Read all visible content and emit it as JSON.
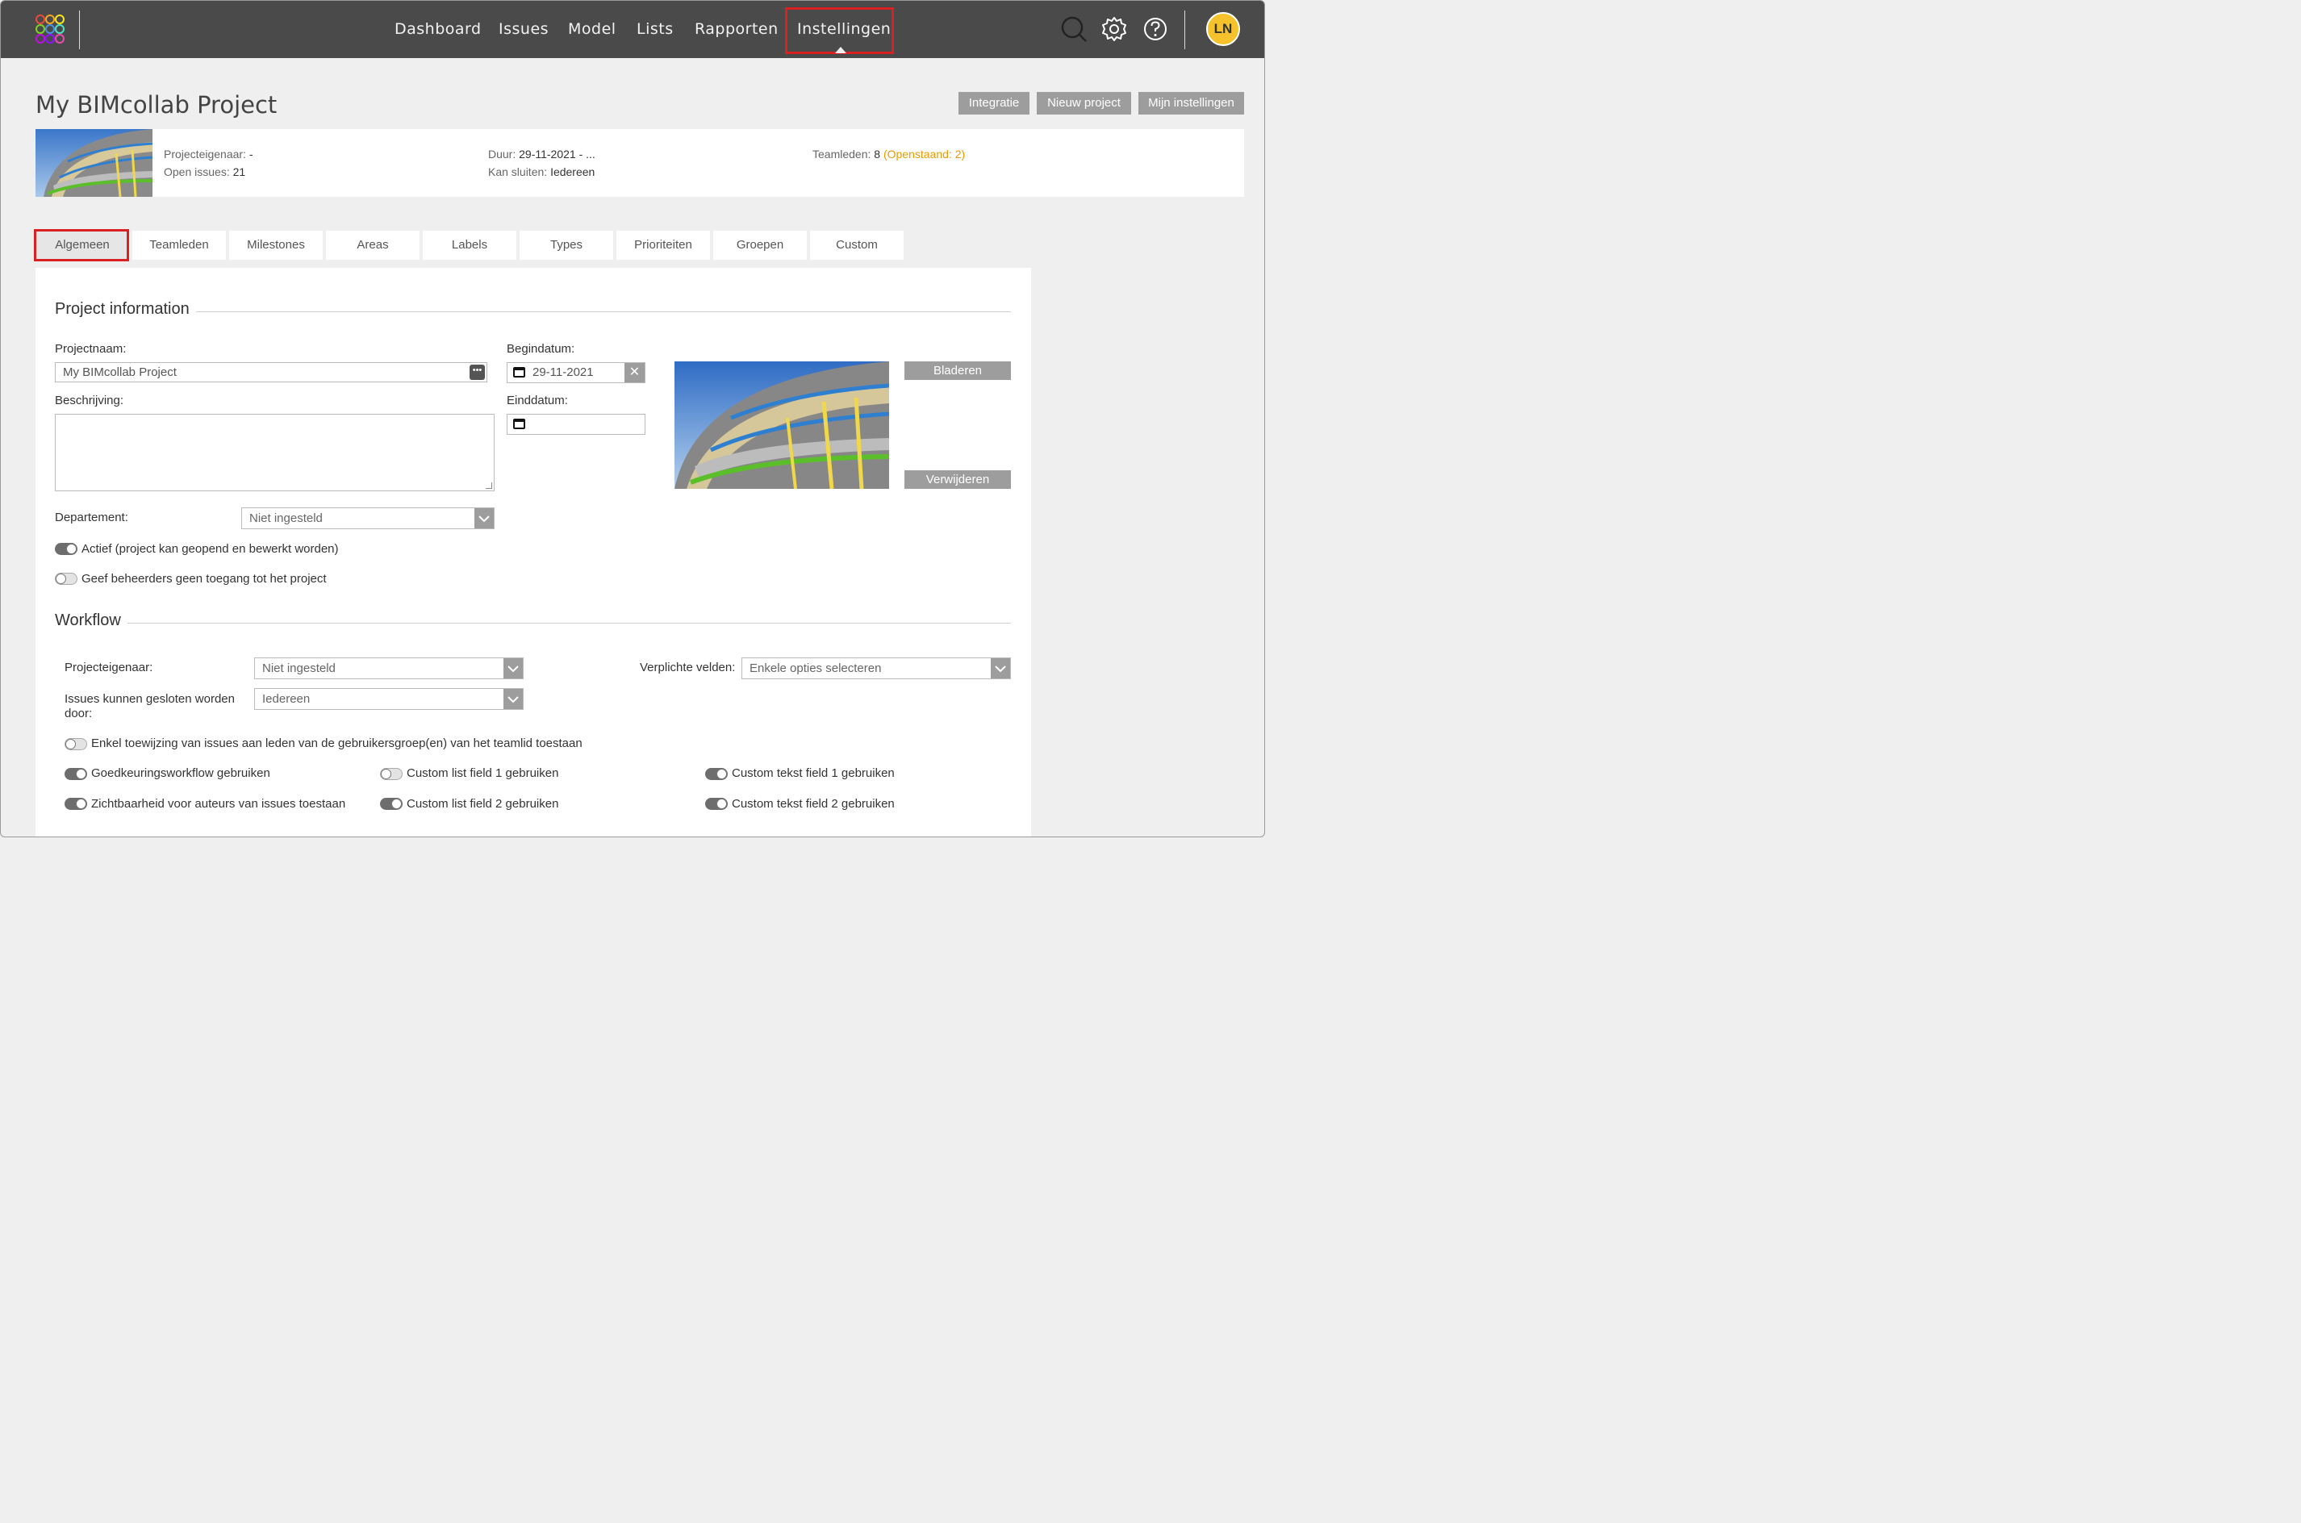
{
  "nav": {
    "items": [
      "Dashboard",
      "Issues",
      "Model",
      "Lists",
      "Rapporten",
      "Instellingen"
    ],
    "active": "Instellingen"
  },
  "user": {
    "initials": "LN"
  },
  "header": {
    "title": "My BIMcollab Project",
    "buttons": [
      "Integratie",
      "Nieuw project",
      "Mijn instellingen"
    ]
  },
  "summary": {
    "owner_label": "Projecteigenaar:",
    "owner_value": "-",
    "open_label": "Open issues:",
    "open_value": "21",
    "duration_label": "Duur:",
    "duration_value": "29-11-2021 - ...",
    "close_label": "Kan sluiten:",
    "close_value": "Iedereen",
    "team_label": "Teamleden:",
    "team_value": "8",
    "team_pending": "(Openstaand: 2)"
  },
  "tabs": [
    "Algemeen",
    "Teamleden",
    "Milestones",
    "Areas",
    "Labels",
    "Types",
    "Prioriteiten",
    "Groepen",
    "Custom"
  ],
  "active_tab": "Algemeen",
  "project_info": {
    "section_title": "Project information",
    "name_label": "Projectnaam:",
    "name_value": "My BIMcollab Project",
    "name_more": "•••",
    "desc_label": "Beschrijving:",
    "start_label": "Begindatum:",
    "start_value": "29-11-2021",
    "start_clear": "✕",
    "end_label": "Einddatum:",
    "browse_button": "Bladeren",
    "remove_button": "Verwijderen",
    "dept_label": "Departement:",
    "dept_value": "Niet ingesteld",
    "toggles": [
      {
        "label": "Actief (project kan geopend en bewerkt worden)",
        "on": true
      },
      {
        "label": "Geef beheerders geen toegang tot het project",
        "on": false
      }
    ]
  },
  "workflow": {
    "section_title": "Workflow",
    "owner_label": "Projecteigenaar:",
    "owner_value": "Niet ingesteld",
    "close_label_1": "Issues kunnen gesloten worden",
    "close_label_2": "door:",
    "close_value": "Iedereen",
    "required_label": "Verplichte velden:",
    "required_placeholder": "Enkele opties selecteren",
    "toggles": [
      {
        "label": "Enkel toewijzing van issues aan leden van de gebruikersgroep(en) van het teamlid toestaan",
        "on": false
      },
      {
        "label": "Goedkeuringsworkflow gebruiken",
        "on": true
      },
      {
        "label": "Custom list field 1 gebruiken",
        "on": false
      },
      {
        "label": "Custom tekst field 1 gebruiken",
        "on": true
      },
      {
        "label": "Zichtbaarheid voor auteurs van issues toestaan",
        "on": true
      },
      {
        "label": "Custom list field 2 gebruiken",
        "on": true
      },
      {
        "label": "Custom tekst field 2 gebruiken",
        "on": true
      }
    ]
  },
  "colors": {
    "topbar": "#4a4a4a",
    "highlight": "#d92022",
    "accent": "#f5c22c",
    "pending": "#e89a00",
    "button": "#9d9d9d"
  }
}
